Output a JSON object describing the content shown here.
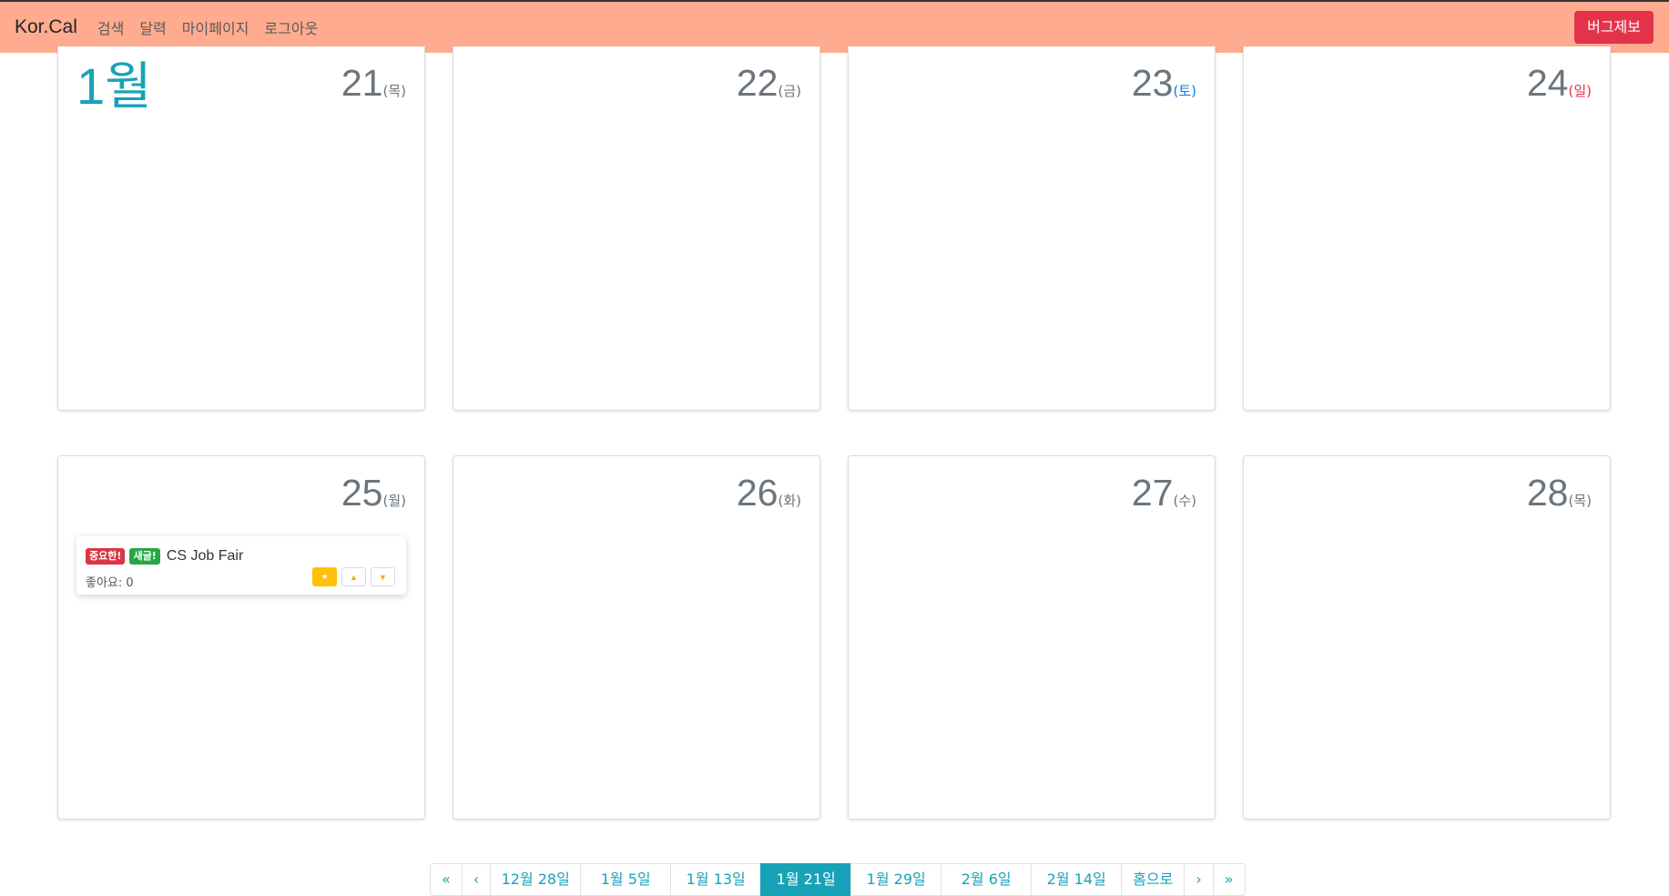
{
  "navbar": {
    "brand": "Kor.Cal",
    "links": [
      "검색",
      "달력",
      "마이페이지",
      "로그아웃"
    ],
    "bug_report": "버그제보"
  },
  "colors": {
    "navbar_bg": "#ffab8f",
    "accent": "#17a2b8",
    "danger": "#dc3545",
    "success": "#28a745",
    "saturday": "#007bff",
    "sunday": "#dc3545"
  },
  "calendar": {
    "month_label": "1월",
    "days": [
      {
        "num": "21",
        "dow": "(목)"
      },
      {
        "num": "22",
        "dow": "(금)"
      },
      {
        "num": "23",
        "dow": "(토)"
      },
      {
        "num": "24",
        "dow": "(일)"
      },
      {
        "num": "25",
        "dow": "(월)"
      },
      {
        "num": "26",
        "dow": "(화)"
      },
      {
        "num": "27",
        "dow": "(수)"
      },
      {
        "num": "28",
        "dow": "(목)"
      }
    ],
    "event": {
      "badge_important": "중요한!",
      "badge_new": "새글!",
      "title": "CS Job Fair",
      "likes": "좋아요: 0",
      "buttons": [
        "star-icon",
        "thumbs-up-icon",
        "thumbs-down-icon"
      ]
    }
  },
  "pagination": {
    "first": "«",
    "prev": "‹",
    "dates": [
      "12월 28일",
      "1월 5일",
      "1월 13일",
      "1월 21일",
      "1월 29일",
      "2월 6일",
      "2월 14일"
    ],
    "active": "1월 21일",
    "home": "홈으로",
    "next": "›",
    "last": "»"
  }
}
